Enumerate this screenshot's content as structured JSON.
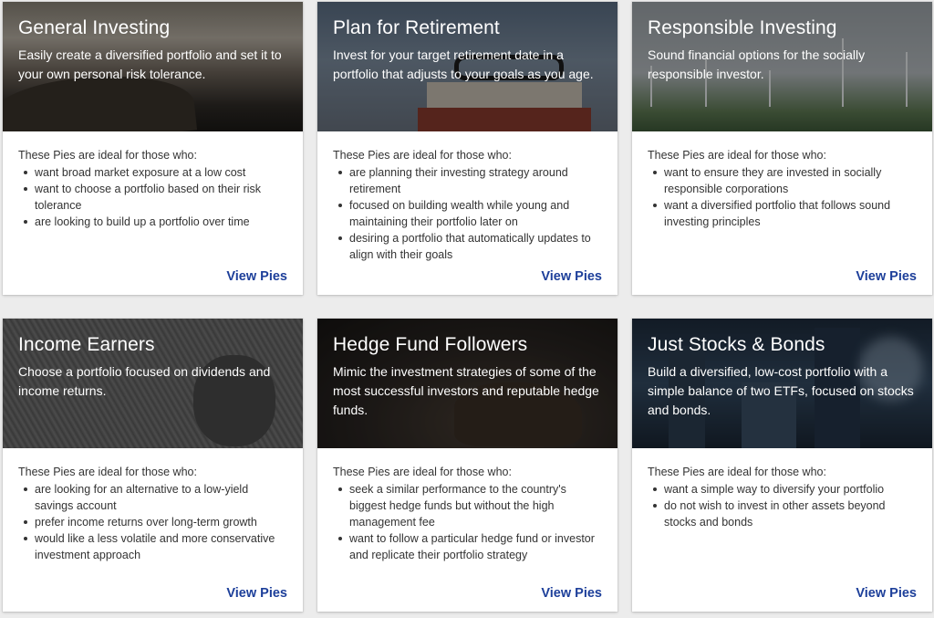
{
  "cards": [
    {
      "title": "General Investing",
      "subtitle": "Easily create a diversified portfolio and set it to your own personal risk tolerance.",
      "intro": "These Pies are ideal for those who:",
      "bullets": [
        "want broad market exposure at a low cost",
        "want to choose a portfolio based on their risk tolerance",
        "are looking to build up a portfolio over time"
      ],
      "cta": "View Pies"
    },
    {
      "title": "Plan for Retirement",
      "subtitle": "Invest for your target retirement date in a portfolio that adjusts to your goals as you age.",
      "intro": "These Pies are ideal for those who:",
      "bullets": [
        "are planning their investing strategy around retirement",
        "focused on building wealth while young and maintaining their portfolio later on",
        "desiring a portfolio that automatically updates to align with their goals"
      ],
      "cta": "View Pies"
    },
    {
      "title": "Responsible Investing",
      "subtitle": "Sound financial options for the socially responsible investor.",
      "intro": "These Pies are ideal for those who:",
      "bullets": [
        "want to ensure they are invested in socially responsible corporations",
        "want a diversified portfolio that follows sound investing principles"
      ],
      "cta": "View Pies"
    },
    {
      "title": "Income Earners",
      "subtitle": "Choose a portfolio focused on dividends and income returns.",
      "intro": "These Pies are ideal for those who:",
      "bullets": [
        "are looking for an alternative to a low-yield savings account",
        "prefer income returns over long-term growth",
        "would like a less volatile and more conservative investment approach"
      ],
      "cta": "View Pies"
    },
    {
      "title": "Hedge Fund Followers",
      "subtitle": "Mimic the investment strategies of some of the most successful investors and reputable hedge funds.",
      "intro": "These Pies are ideal for those who:",
      "bullets": [
        "seek a similar performance to the country's biggest hedge funds but without the high management fee",
        "want to follow a particular hedge fund or investor and replicate their portfolio strategy"
      ],
      "cta": "View Pies"
    },
    {
      "title": "Just Stocks & Bonds",
      "subtitle": "Build a diversified, low-cost portfolio with a simple balance of two ETFs, focused on stocks and bonds.",
      "intro": "These Pies are ideal for those who:",
      "bullets": [
        "want a simple way to diversify your portfolio",
        "do not wish to invest in other assets beyond stocks and bonds"
      ],
      "cta": "View Pies"
    }
  ],
  "colors": {
    "cta": "#1d3f9a",
    "page_background": "#ececec"
  }
}
